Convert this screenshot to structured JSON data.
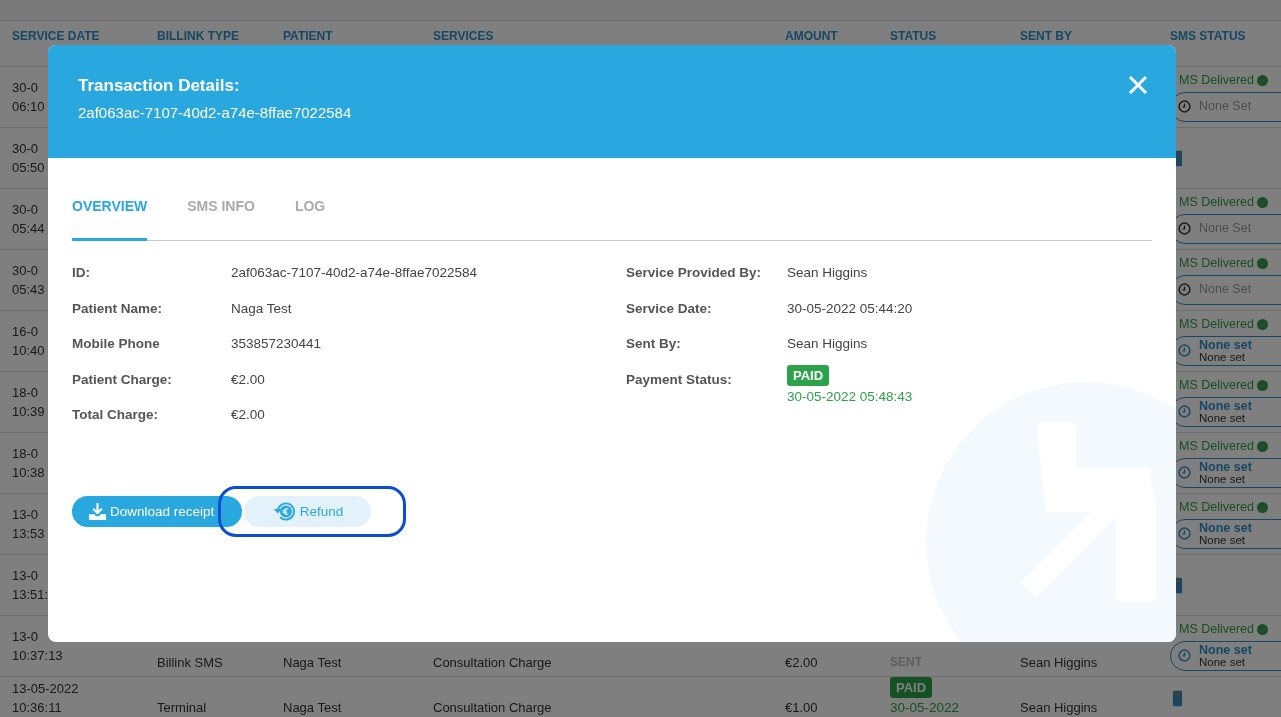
{
  "table": {
    "columns": [
      "SERVICE DATE",
      "BILLINK TYPE",
      "PATIENT",
      "SERVICES",
      "AMOUNT",
      "STATUS",
      "SENT BY",
      "SMS STATUS"
    ],
    "rows": [
      {
        "date": "30-0",
        "time": "06:10",
        "sms": {
          "kind": "sms",
          "text": "MS Delivered",
          "schedule": {
            "kind": "unset",
            "label": "None Set"
          }
        }
      },
      {
        "date": "30-0",
        "time": "05:50",
        "sms": {
          "kind": "terminal"
        }
      },
      {
        "date": "30-0",
        "time": "05:44",
        "sms": {
          "kind": "sms",
          "text": "MS Delivered",
          "schedule": {
            "kind": "unset",
            "label": "None Set"
          }
        }
      },
      {
        "date": "30-0",
        "time": "05:43",
        "sms": {
          "kind": "sms",
          "text": "MS Delivered",
          "schedule": {
            "kind": "unset",
            "label": "None Set"
          }
        }
      },
      {
        "date": "16-0",
        "time": "10:40",
        "sms": {
          "kind": "sms",
          "text": "MS Delivered",
          "schedule": {
            "kind": "set",
            "label": "None set",
            "sublabel": "None set"
          }
        }
      },
      {
        "date": "18-0",
        "time": "10:39",
        "sms": {
          "kind": "sms",
          "text": "MS Delivered",
          "schedule": {
            "kind": "set",
            "label": "None set",
            "sublabel": "None set"
          }
        }
      },
      {
        "date": "18-0",
        "time": "10:38",
        "sms": {
          "kind": "sms",
          "text": "MS Delivered",
          "schedule": {
            "kind": "set",
            "label": "None set",
            "sublabel": "None set"
          }
        }
      },
      {
        "date": "13-0",
        "time": "13:53",
        "sms": {
          "kind": "sms",
          "text": "MS Delivered",
          "schedule": {
            "kind": "set",
            "label": "None set",
            "sublabel": "None set"
          }
        }
      },
      {
        "date": "13-0",
        "time": "13:51:",
        "sms": {
          "kind": "terminal"
        }
      },
      {
        "date": "13-0",
        "time": "10:37:13",
        "type": "Billink SMS",
        "patient": "Naga Test",
        "services": "Consultation Charge",
        "amount": "€2.00",
        "status": {
          "kind": "sent",
          "label": "SENT"
        },
        "sent_by": "Sean Higgins",
        "sms": {
          "kind": "sms",
          "text": "MS Delivered",
          "schedule": {
            "kind": "set",
            "label": "None set",
            "sublabel": "None set"
          }
        }
      },
      {
        "date": "13-05-2022",
        "time": "10:36:11",
        "type": "Terminal",
        "patient": "Naga Test",
        "services": "Consultation Charge",
        "amount": "€1.00",
        "status": {
          "kind": "paid",
          "label": "PAID",
          "date": "30-05-2022"
        },
        "sent_by": "Sean Higgins",
        "sms": {
          "kind": "terminal"
        }
      }
    ]
  },
  "modal": {
    "title": "Transaction Details:",
    "subtitle": "2af063ac-7107-40d2-a74e-8ffae7022584",
    "tabs": [
      {
        "label": "OVERVIEW",
        "selected": true
      },
      {
        "label": "SMS INFO",
        "selected": false
      },
      {
        "label": "LOG",
        "selected": false
      }
    ],
    "left_fields": [
      {
        "label": "ID:",
        "value": "2af063ac-7107-40d2-a74e-8ffae7022584"
      },
      {
        "label": "Patient Name:",
        "value": "Naga Test"
      },
      {
        "label": "Mobile Phone",
        "value": "353857230441"
      },
      {
        "label": "Patient Charge:",
        "value": "€2.00"
      },
      {
        "label": "Total Charge:",
        "value": "€2.00"
      }
    ],
    "right_fields": [
      {
        "label": "Service Provided By:",
        "value": "Sean Higgins"
      },
      {
        "label": "Service Date:",
        "value": "30-05-2022 05:44:20"
      },
      {
        "label": "Sent By:",
        "value": "Sean Higgins"
      },
      {
        "label": "Payment Status:",
        "badge": "PAID",
        "value": "30-05-2022 05:48:43"
      }
    ],
    "buttons": [
      {
        "kind": "download",
        "label": "Download receipt"
      },
      {
        "kind": "refund",
        "label": "Refund",
        "highlighted": true
      }
    ]
  }
}
